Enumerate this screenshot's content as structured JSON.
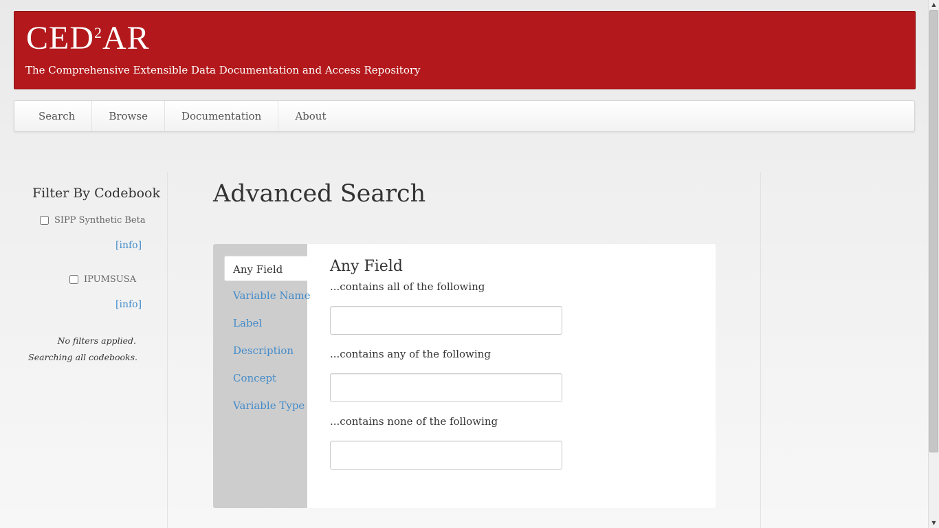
{
  "header": {
    "logo_main": "CED",
    "logo_sup": "2",
    "logo_end": "AR",
    "tagline": "The Comprehensive Extensible Data Documentation and Access Repository"
  },
  "nav": {
    "items": [
      {
        "label": "Search"
      },
      {
        "label": "Browse"
      },
      {
        "label": "Documentation"
      },
      {
        "label": "About"
      }
    ]
  },
  "sidebar": {
    "title": "Filter By Codebook",
    "codebooks": [
      {
        "label": "SIPP Synthetic Beta",
        "info": "[info]",
        "checked": false
      },
      {
        "label": "IPUMSUSA",
        "info": "[info]",
        "checked": false
      }
    ],
    "note_line1": "No filters applied.",
    "note_line2": "Searching all codebooks."
  },
  "main": {
    "title": "Advanced Search",
    "tabs": [
      {
        "label": "Any Field",
        "active": true
      },
      {
        "label": "Variable Name"
      },
      {
        "label": "Label"
      },
      {
        "label": "Description"
      },
      {
        "label": "Concept"
      },
      {
        "label": "Variable Type"
      }
    ],
    "pane_title": "Any Field",
    "fields": [
      {
        "label": "...contains all of the following",
        "value": ""
      },
      {
        "label": "...contains any of the following",
        "value": ""
      },
      {
        "label": "...contains none of the following",
        "value": ""
      }
    ]
  },
  "colors": {
    "header_bg": "#b3191c",
    "link": "#428bca",
    "tab_column": "#cdcdcd"
  },
  "scrollbar": {
    "up_arrow": "▲",
    "down_arrow": "▼"
  }
}
